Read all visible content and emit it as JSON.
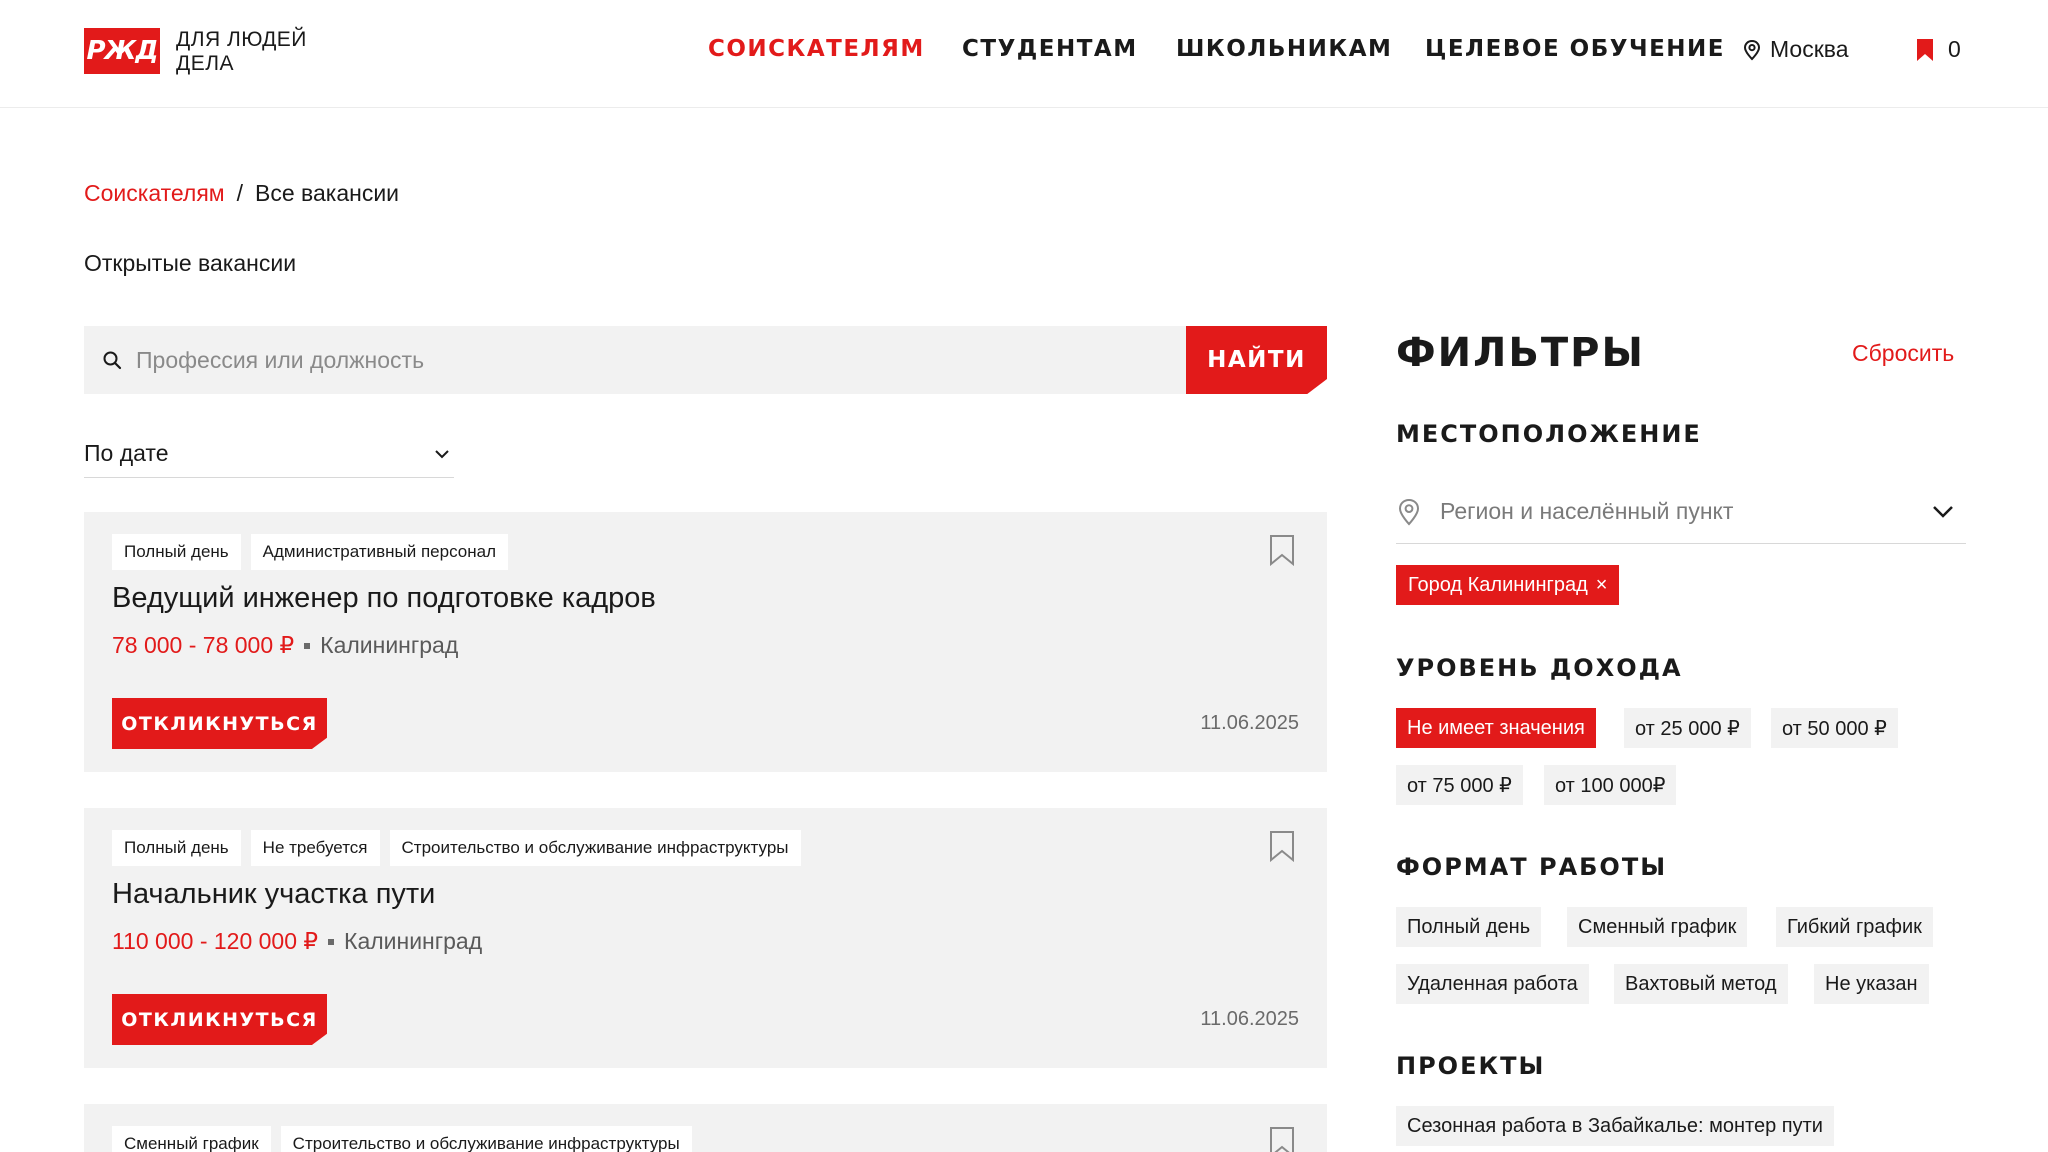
{
  "header": {
    "logo_text": "РЖД",
    "slogan_line1": "ДЛЯ ЛЮДЕЙ",
    "slogan_line2": "ДЕЛА",
    "nav": [
      {
        "label": "СОИСКАТЕЛЯМ",
        "active": true
      },
      {
        "label": "СТУДЕНТАМ",
        "active": false
      },
      {
        "label": "ШКОЛЬНИКАМ",
        "active": false
      },
      {
        "label": "ЦЕЛЕВОЕ ОБУЧЕНИЕ",
        "active": false
      }
    ],
    "city": "Москва",
    "favorites_count": "0"
  },
  "breadcrumb": {
    "parent": "Соискателям",
    "separator": "/",
    "current": "Все вакансии"
  },
  "page_subtitle": "Открытые вакансии",
  "search": {
    "placeholder": "Профессия или должность",
    "button_label": "НАЙТИ"
  },
  "sort": {
    "selected": "По дате"
  },
  "vacancies": [
    {
      "tags": [
        "Полный день",
        "Административный персонал"
      ],
      "title": "Ведущий инженер по подготовке кадров",
      "salary": "78 000 - 78 000 ₽",
      "location": "Калининград",
      "apply_label": "ОТКЛИКНУТЬСЯ",
      "date": "11.06.2025"
    },
    {
      "tags": [
        "Полный день",
        "Не требуется",
        "Строительство и обслуживание инфраструктуры"
      ],
      "title": "Начальник участка пути",
      "salary": "110 000 - 120 000 ₽",
      "location": "Калининград",
      "apply_label": "ОТКЛИКНУТЬСЯ",
      "date": "11.06.2025"
    },
    {
      "tags": [
        "Сменный график",
        "Строительство и обслуживание инфраструктуры"
      ]
    }
  ],
  "filters": {
    "title": "ФИЛЬТРЫ",
    "reset_label": "Сбросить",
    "location": {
      "title": "МЕСТОПОЛОЖЕНИЕ",
      "placeholder": "Регион и населённый пункт",
      "selected_chip": "Город Калининград",
      "chip_remove": "×"
    },
    "income": {
      "title": "УРОВЕНЬ ДОХОДА",
      "options": [
        "Не имеет значения",
        "от 25 000 ₽",
        "от 50 000 ₽",
        "от 75 000 ₽",
        "от 100 000₽"
      ],
      "selected": "Не имеет значения"
    },
    "work_format": {
      "title": "ФОРМАТ РАБОТЫ",
      "options": [
        "Полный день",
        "Сменный график",
        "Гибкий график",
        "Удаленная работа",
        "Вахтовый метод",
        "Не указан"
      ]
    },
    "projects": {
      "title": "ПРОЕКТЫ",
      "options": [
        "Сезонная работа в Забайкалье: монтер пути"
      ]
    }
  },
  "colors": {
    "accent": "#e21a1a",
    "card_bg": "#f2f2f2",
    "text": "#1a1a1a"
  }
}
